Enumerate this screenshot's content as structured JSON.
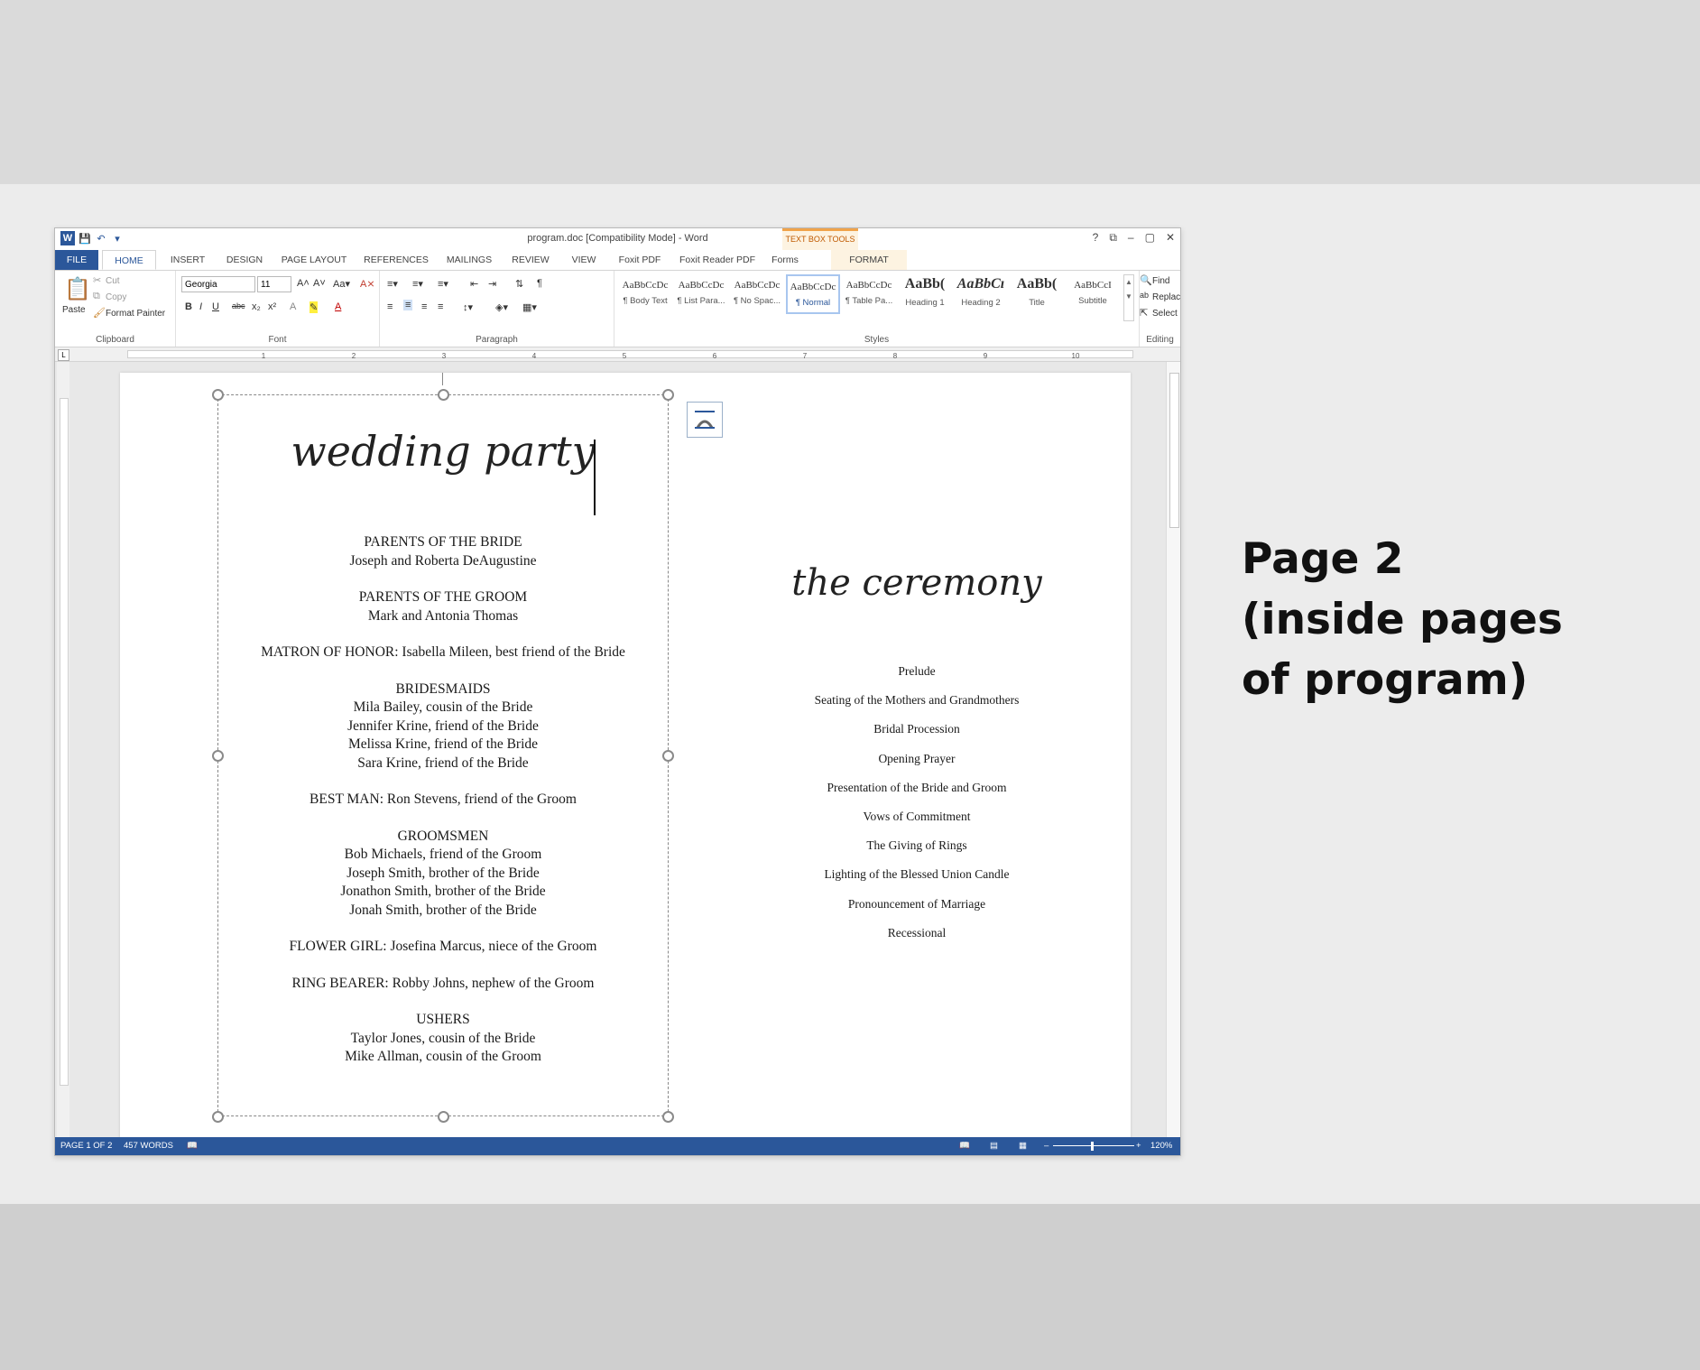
{
  "window": {
    "title": "program.doc [Compatibility Mode] - Word",
    "context_tab_group": "TEXT BOX TOOLS",
    "controls": [
      "?",
      "⧉",
      "–",
      "▢",
      "✕"
    ]
  },
  "tabs": [
    "FILE",
    "HOME",
    "INSERT",
    "DESIGN",
    "PAGE LAYOUT",
    "REFERENCES",
    "MAILINGS",
    "REVIEW",
    "VIEW",
    "Foxit PDF",
    "Foxit Reader PDF",
    "Forms",
    "FORMAT"
  ],
  "active_tab": "HOME",
  "ribbon": {
    "clipboard": {
      "paste": "Paste",
      "cut": "Cut",
      "copy": "Copy",
      "format_painter": "Format Painter",
      "label": "Clipboard"
    },
    "font": {
      "name": "Georgia",
      "size": "11",
      "label": "Font"
    },
    "paragraph": {
      "label": "Paragraph"
    },
    "styles": {
      "label": "Styles",
      "items": [
        {
          "sample": "AaBbCcDc",
          "name": "¶ Body Text"
        },
        {
          "sample": "AaBbCcDc",
          "name": "¶ List Para..."
        },
        {
          "sample": "AaBbCcDc",
          "name": "¶ No Spac..."
        },
        {
          "sample": "AaBbCcDc",
          "name": "¶ Normal"
        },
        {
          "sample": "AaBbCcDc",
          "name": "¶ Table Pa..."
        },
        {
          "sample": "AaBb(",
          "name": "Heading 1"
        },
        {
          "sample": "AaBbCı",
          "name": "Heading 2"
        },
        {
          "sample": "AaBb(",
          "name": "Title"
        },
        {
          "sample": "AaBbCcI",
          "name": "Subtitle"
        }
      ],
      "selected": "¶ Normal"
    },
    "editing": {
      "find": "Find",
      "replace": "Replace",
      "select": "Select",
      "label": "Editing"
    }
  },
  "ruler": {
    "numbers": [
      "1",
      "2",
      "3",
      "4",
      "5",
      "6",
      "7",
      "8",
      "9",
      "10"
    ]
  },
  "document": {
    "left_title": "wedding party",
    "party": [
      [
        "PARENTS OF THE BRIDE",
        "Joseph and Roberta DeAugustine"
      ],
      [
        "PARENTS OF THE GROOM",
        "Mark and Antonia Thomas"
      ],
      [
        "MATRON OF HONOR:  Isabella Mileen, best friend of the Bride"
      ],
      [
        "BRIDESMAIDS",
        "Mila Bailey, cousin of the Bride",
        "Jennifer Krine, friend of the Bride",
        "Melissa Krine, friend of the Bride",
        "Sara Krine, friend of the Bride"
      ],
      [
        "BEST MAN:  Ron Stevens, friend of the Groom"
      ],
      [
        "GROOMSMEN",
        "Bob Michaels, friend of the Groom",
        "Joseph Smith, brother of the Bride",
        "Jonathon Smith, brother of the Bride",
        "Jonah Smith, brother of the Bride"
      ],
      [
        "FLOWER GIRL:  Josefina Marcus, niece of the Groom"
      ],
      [
        "RING BEARER:  Robby Johns, nephew of the Groom"
      ],
      [
        "USHERS",
        "Taylor Jones, cousin of the Bride",
        "Mike Allman, cousin of the Groom"
      ]
    ],
    "right_title": "the ceremony",
    "ceremony": [
      "Prelude",
      "Seating of the Mothers and Grandmothers",
      "Bridal Procession",
      "Opening Prayer",
      "Presentation of the Bride and Groom",
      "Vows of Commitment",
      "The Giving of Rings",
      "Lighting of the Blessed Union Candle",
      "Pronouncement of Marriage",
      "Recessional"
    ]
  },
  "status": {
    "page": "PAGE 1 OF 2",
    "words": "457 WORDS",
    "zoom": "120%"
  },
  "caption": [
    "Page 2",
    "(inside pages",
    "of program)"
  ],
  "colors": {
    "accent": "#2b579a",
    "context": "#f0a34a"
  }
}
